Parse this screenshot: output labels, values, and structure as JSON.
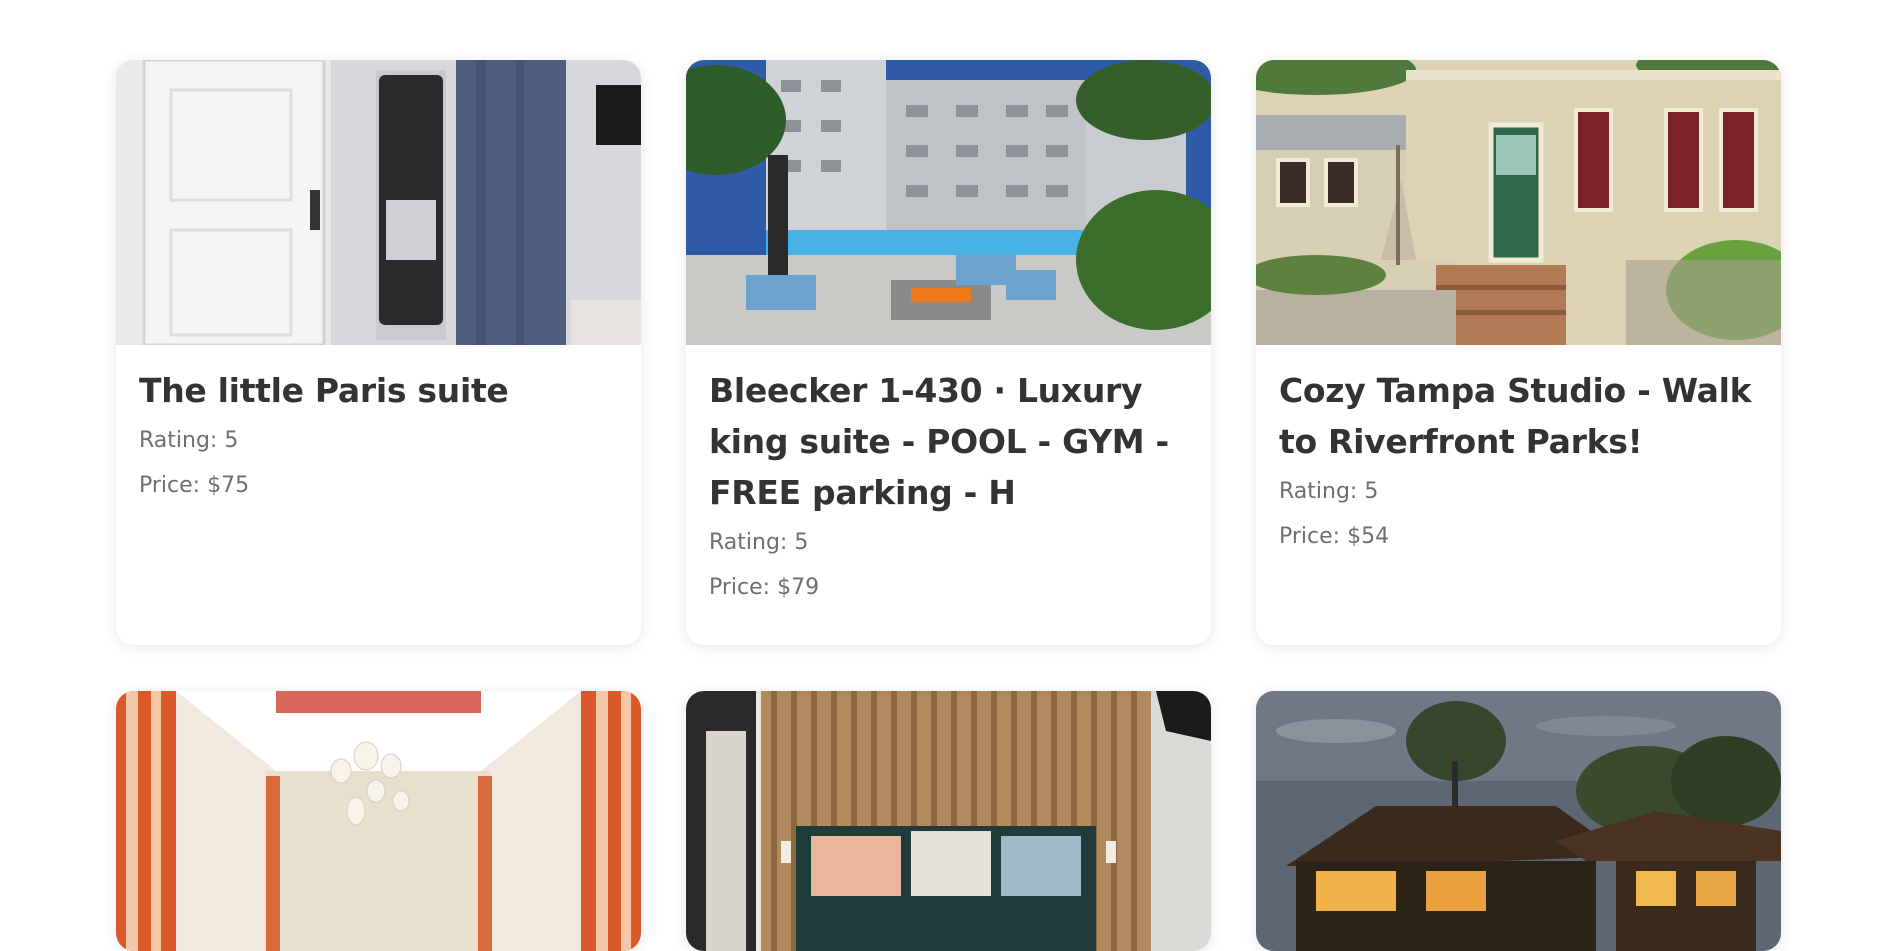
{
  "listings": [
    {
      "title": "The little Paris suite",
      "rating": "Rating: 5",
      "price": "Price: $75"
    },
    {
      "title": "Bleecker 1-430 · Luxury king suite - POOL - GYM - FREE parking - H",
      "rating": "Rating: 5",
      "price": "Price: $79"
    },
    {
      "title": "Cozy Tampa Studio - Walk to Riverfront Parks!",
      "rating": "Rating: 5",
      "price": "Price: $54"
    }
  ],
  "photo_icons": [
    "bedroom-door-photo",
    "pool-courtyard-photo",
    "cottage-porch-photo",
    "lobby-chandelier-photo",
    "wood-panel-bedroom-photo",
    "house-at-dusk-photo"
  ],
  "colors": {
    "title": "#333333",
    "meta": "#6f6f6f",
    "card_bg": "#ffffff"
  }
}
